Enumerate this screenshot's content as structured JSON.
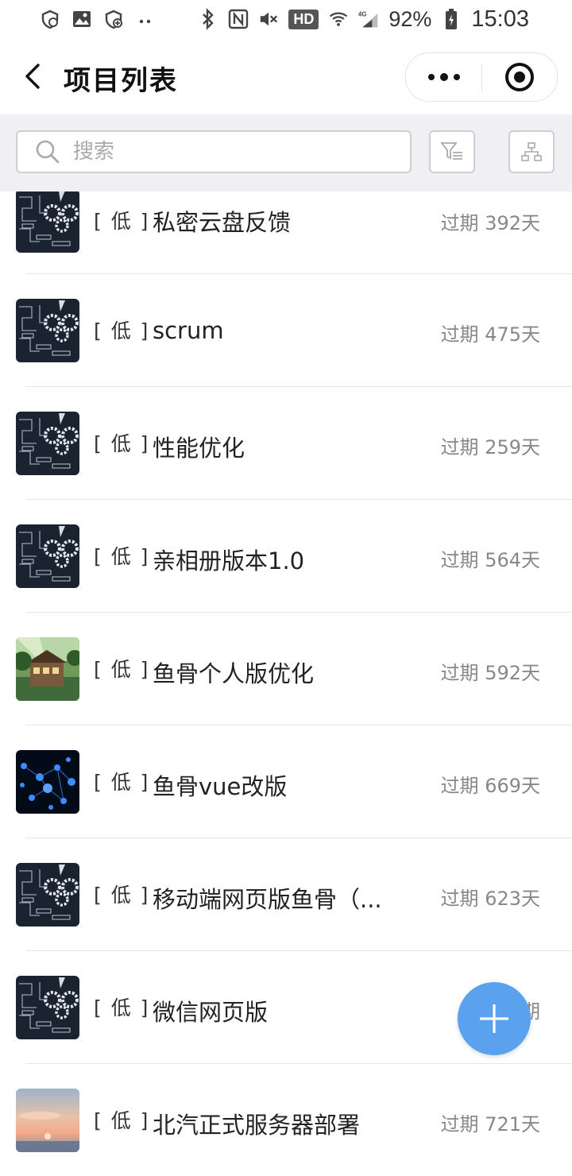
{
  "status_bar": {
    "battery_percent": "92%",
    "time": "15:03",
    "hd_label": "HD",
    "network_label": "4G",
    "icons": [
      "shield-icon",
      "image-icon",
      "shield-plus-icon",
      "more-dots-icon",
      "bluetooth-icon",
      "nfc-icon",
      "mute-icon",
      "hd-icon",
      "wifi-icon",
      "signal-icon",
      "battery-icon"
    ]
  },
  "nav": {
    "title": "项目列表",
    "back_icon": "chevron-left-icon",
    "more_icon": "more-dots-icon",
    "close_icon": "target-icon"
  },
  "search": {
    "placeholder": "搜索",
    "filter_icon": "filter-icon",
    "tree_icon": "org-tree-icon"
  },
  "projects": [
    {
      "priority": "[ 低 ]",
      "name": "私密云盘反馈",
      "overdue": "过期 392天",
      "thumb": "gears-tech"
    },
    {
      "priority": "[ 低 ]",
      "name": "scrum",
      "overdue": "过期 475天",
      "thumb": "gears-tech"
    },
    {
      "priority": "[ 低 ]",
      "name": "性能优化",
      "overdue": "过期 259天",
      "thumb": "gears-tech"
    },
    {
      "priority": "[ 低 ]",
      "name": "亲相册版本1.0",
      "overdue": "过期 564天",
      "thumb": "gears-tech"
    },
    {
      "priority": "[ 低 ]",
      "name": "鱼骨个人版优化",
      "overdue": "过期 592天",
      "thumb": "forest-house"
    },
    {
      "priority": "[ 低 ]",
      "name": "鱼骨vue改版",
      "overdue": "过期 669天",
      "thumb": "blue-network"
    },
    {
      "priority": "[ 低 ]",
      "name": "移动端网页版鱼骨（...",
      "overdue": "过期 623天",
      "thumb": "gears-tech"
    },
    {
      "priority": "[ 低 ]",
      "name": "微信网页版",
      "overdue": "过期",
      "thumb": "gears-tech"
    },
    {
      "priority": "[ 低 ]",
      "name": "北汽正式服务器部署",
      "overdue": "过期 721天",
      "thumb": "sunset-sky"
    }
  ],
  "fab": {
    "icon": "plus-icon"
  },
  "colors": {
    "accent": "#5aa2ee",
    "search_bg": "#efeff4",
    "muted_text": "#888888"
  }
}
